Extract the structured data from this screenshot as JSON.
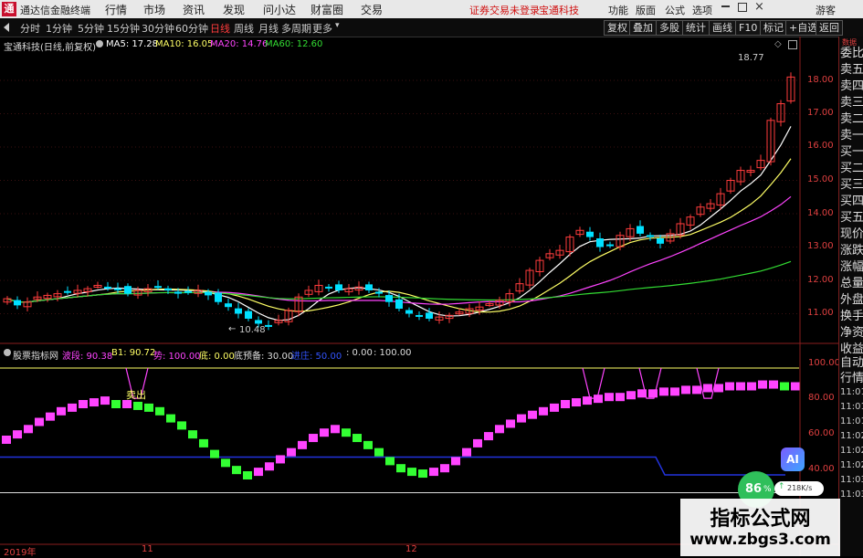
{
  "title_bar": {
    "logo_glyph": "通",
    "app_name": "通达信金融终端",
    "menu": [
      "行情",
      "市场",
      "资讯",
      "发现",
      "问小达",
      "财富圈",
      "交易"
    ],
    "warning": "证券交易未登录",
    "stock_name": "宝通科技",
    "right_menu": [
      "功能",
      "版面",
      "公式",
      "选项"
    ],
    "guest": "游客"
  },
  "toolbar": {
    "periods": [
      "分时",
      "1分钟",
      "5分钟",
      "15分钟",
      "30分钟",
      "60分钟",
      "日线",
      "周线",
      "月线",
      "多周期",
      "更多"
    ],
    "active_period": "日线",
    "right_buttons": [
      "复权",
      "叠加",
      "多股",
      "统计",
      "画线",
      "F10",
      "标记",
      "+自选",
      "返回"
    ]
  },
  "price_panel": {
    "header": {
      "stock": "宝通科技(日线,前复权)",
      "ma5": "MA5: 17.28",
      "ma10": "MA10: 16.05",
      "ma20": "MA20: 14.76",
      "ma60": "MA60: 12.60"
    },
    "high_label": "18.77",
    "low_label": "10.48",
    "axis_labels": [
      "18.00",
      "17.00",
      "16.00",
      "15.00",
      "14.00",
      "13.00",
      "12.00",
      "11.00"
    ]
  },
  "indicator_panel": {
    "header": {
      "name": "股票指标网",
      "bo": "波段: 90.38",
      "b1": "B1: 90.72",
      "su": "势: 100.00",
      "di": "底: 0.00",
      "dibei": "底预备: 30.00",
      "zhuang": "进庄: 50.00",
      "v1": ": 0.00",
      "v2": ": 100.00"
    },
    "sell_label": "卖出",
    "axis_labels": [
      "100.00",
      "80.00",
      "60.00",
      "40.00"
    ]
  },
  "right_panel": {
    "top_label": "数据",
    "labels": [
      "委比",
      "卖五",
      "卖四",
      "卖三",
      "卖二",
      "卖一",
      "买一",
      "买二",
      "买三",
      "买四",
      "买五",
      "现价",
      "涨跌",
      "涨幅",
      "总量",
      "外盘",
      "换手",
      "净资",
      "收益"
    ],
    "lower_label_1": "自动",
    "lower_label_2": "行情",
    "times": [
      "11:01",
      "11:01",
      "11:01",
      "11:02",
      "11:02",
      "11:02",
      "11:03",
      "11:03"
    ]
  },
  "date_axis": [
    "2019年",
    "11",
    "12"
  ],
  "overlays": {
    "ai": "AI",
    "gauge": "86",
    "gauge_unit": "%",
    "speed": "218K/s"
  },
  "watermark": {
    "line1": "指标公式网",
    "line2": "www.zbgs3.com"
  },
  "colors": {
    "up": "#ff3c3c",
    "down": "#00e0ff",
    "ma5": "#ffffff",
    "ma10": "#ffff66",
    "ma20": "#ff44ff",
    "ma60": "#33dd33",
    "indicator_magenta": "#ff44ff",
    "indicator_green": "#33ff33"
  }
}
